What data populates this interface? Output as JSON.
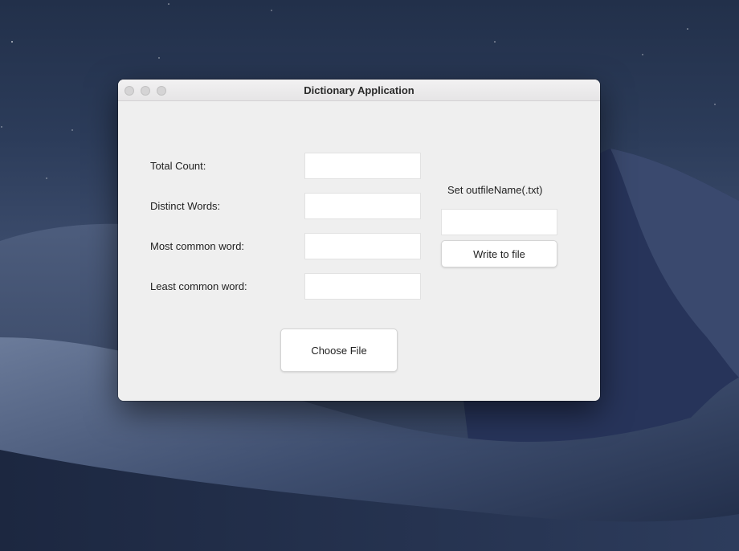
{
  "window": {
    "title": "Dictionary Application"
  },
  "stats": {
    "total_count_label": "Total Count:",
    "total_count_value": "",
    "distinct_words_label": "Distinct Words:",
    "distinct_words_value": "",
    "most_common_label": "Most common word:",
    "most_common_value": "",
    "least_common_label": "Least common word:",
    "least_common_value": ""
  },
  "output": {
    "filename_label": "Set outfileName(.txt)",
    "filename_value": "",
    "write_button_label": "Write to file"
  },
  "actions": {
    "choose_file_label": "Choose File"
  },
  "colors": {
    "window_bg": "#efefef",
    "titlebar_bg": "#e9e8e9",
    "traffic_light_inactive": "#d5d4d5",
    "field_bg": "#ffffff",
    "button_bg": "#ffffff"
  }
}
